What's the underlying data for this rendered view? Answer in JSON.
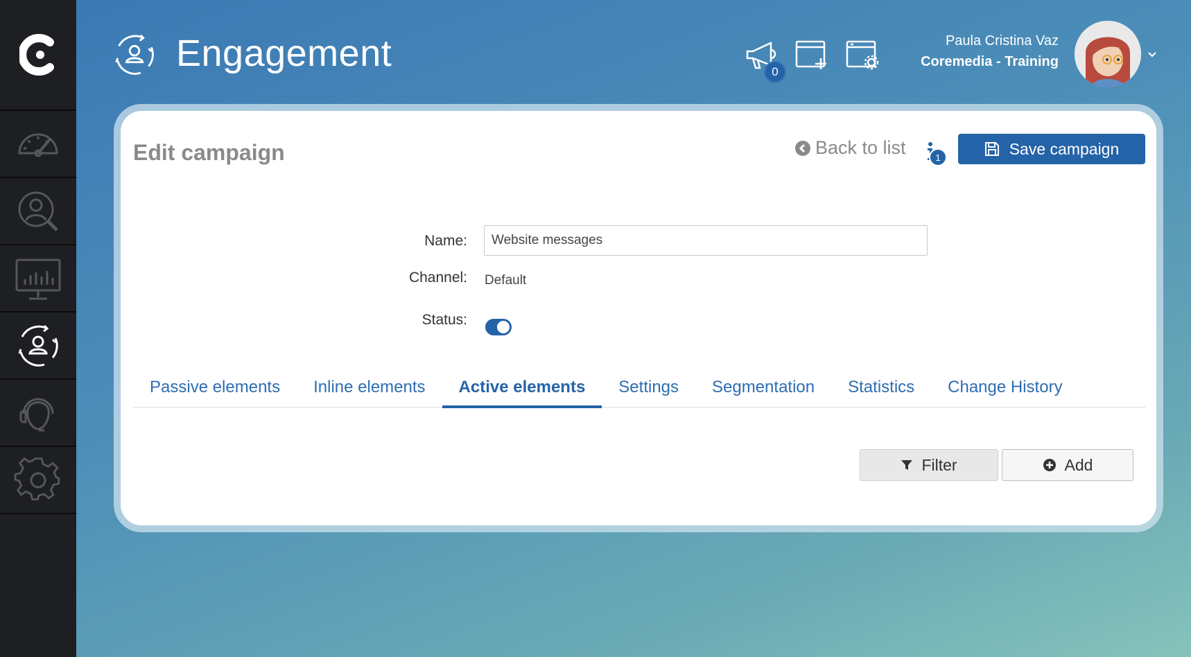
{
  "app": {
    "title": "Engagement",
    "header_icon": "engagement-cycle-icon"
  },
  "sidebar": {
    "logo": "coremedia-logo",
    "items": [
      {
        "name": "dashboard",
        "icon": "speedometer-icon",
        "active": false
      },
      {
        "name": "users-search",
        "icon": "user-search-icon",
        "active": false
      },
      {
        "name": "analytics",
        "icon": "monitor-chart-icon",
        "active": false
      },
      {
        "name": "engagement",
        "icon": "engagement-cycle-icon",
        "active": true
      },
      {
        "name": "support",
        "icon": "headset-icon",
        "active": false
      },
      {
        "name": "settings",
        "icon": "gear-icon",
        "active": false
      }
    ]
  },
  "header": {
    "announcements_badge": "0",
    "tools": [
      "megaphone-icon",
      "new-window-icon",
      "window-settings-icon"
    ],
    "user": {
      "name": "Paula Cristina Vaz",
      "org": "Coremedia - Training"
    }
  },
  "card": {
    "title": "Edit campaign",
    "back_label": "Back to list",
    "info_badge": "1",
    "save_label": "Save campaign"
  },
  "form": {
    "name_label": "Name:",
    "name_value": "Website messages",
    "channel_label": "Channel:",
    "channel_value": "Default",
    "status_label": "Status:",
    "status_on": true
  },
  "tabs": [
    {
      "label": "Passive elements",
      "active": false
    },
    {
      "label": "Inline elements",
      "active": false
    },
    {
      "label": "Active elements",
      "active": true
    },
    {
      "label": "Settings",
      "active": false
    },
    {
      "label": "Segmentation",
      "active": false
    },
    {
      "label": "Statistics",
      "active": false
    },
    {
      "label": "Change History",
      "active": false
    }
  ],
  "actions": {
    "filter_label": "Filter",
    "add_label": "Add"
  },
  "colors": {
    "accent": "#2563a8",
    "sidebar": "#1e1f22",
    "tab_text": "#2e6db3"
  }
}
